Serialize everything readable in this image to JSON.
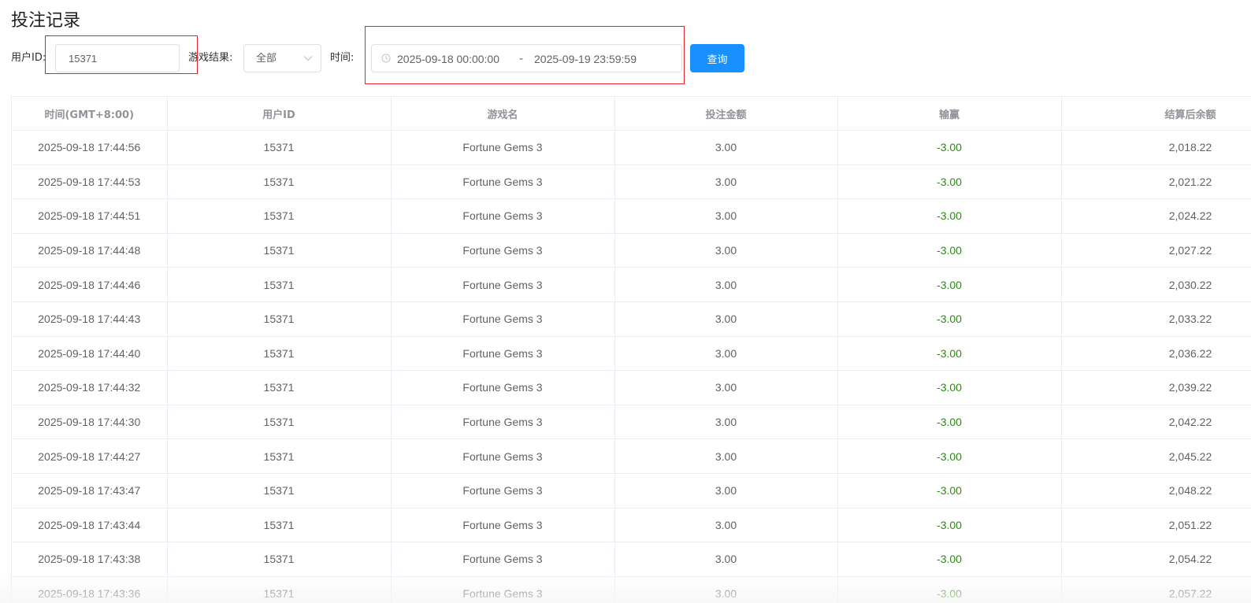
{
  "page_title": "投注记录",
  "filters": {
    "user_id_label": "用户ID:",
    "user_id_value": "15371",
    "result_label": "游戏结果:",
    "result_selected": "全部",
    "time_label": "时间:",
    "time_start": "2025-09-18 00:00:00",
    "time_separator": "-",
    "time_end": "2025-09-19 23:59:59",
    "query_button": "查询"
  },
  "colors": {
    "primary": "#1890ff",
    "win_loss": "#2c8a12",
    "highlight_box": "#e8202a"
  },
  "table": {
    "columns": [
      "时间(GMT+8:00)",
      "用户ID",
      "游戏名",
      "投注金额",
      "输赢",
      "结算后余额"
    ],
    "rows": [
      [
        "2025-09-18 17:44:56",
        "15371",
        "Fortune Gems 3",
        "3.00",
        "-3.00",
        "2,018.22"
      ],
      [
        "2025-09-18 17:44:53",
        "15371",
        "Fortune Gems 3",
        "3.00",
        "-3.00",
        "2,021.22"
      ],
      [
        "2025-09-18 17:44:51",
        "15371",
        "Fortune Gems 3",
        "3.00",
        "-3.00",
        "2,024.22"
      ],
      [
        "2025-09-18 17:44:48",
        "15371",
        "Fortune Gems 3",
        "3.00",
        "-3.00",
        "2,027.22"
      ],
      [
        "2025-09-18 17:44:46",
        "15371",
        "Fortune Gems 3",
        "3.00",
        "-3.00",
        "2,030.22"
      ],
      [
        "2025-09-18 17:44:43",
        "15371",
        "Fortune Gems 3",
        "3.00",
        "-3.00",
        "2,033.22"
      ],
      [
        "2025-09-18 17:44:40",
        "15371",
        "Fortune Gems 3",
        "3.00",
        "-3.00",
        "2,036.22"
      ],
      [
        "2025-09-18 17:44:32",
        "15371",
        "Fortune Gems 3",
        "3.00",
        "-3.00",
        "2,039.22"
      ],
      [
        "2025-09-18 17:44:30",
        "15371",
        "Fortune Gems 3",
        "3.00",
        "-3.00",
        "2,042.22"
      ],
      [
        "2025-09-18 17:44:27",
        "15371",
        "Fortune Gems 3",
        "3.00",
        "-3.00",
        "2,045.22"
      ],
      [
        "2025-09-18 17:43:47",
        "15371",
        "Fortune Gems 3",
        "3.00",
        "-3.00",
        "2,048.22"
      ],
      [
        "2025-09-18 17:43:44",
        "15371",
        "Fortune Gems 3",
        "3.00",
        "-3.00",
        "2,051.22"
      ],
      [
        "2025-09-18 17:43:38",
        "15371",
        "Fortune Gems 3",
        "3.00",
        "-3.00",
        "2,054.22"
      ],
      [
        "2025-09-18 17:43:36",
        "15371",
        "Fortune Gems 3",
        "3.00",
        "-3.00",
        "2,057.22"
      ]
    ]
  }
}
